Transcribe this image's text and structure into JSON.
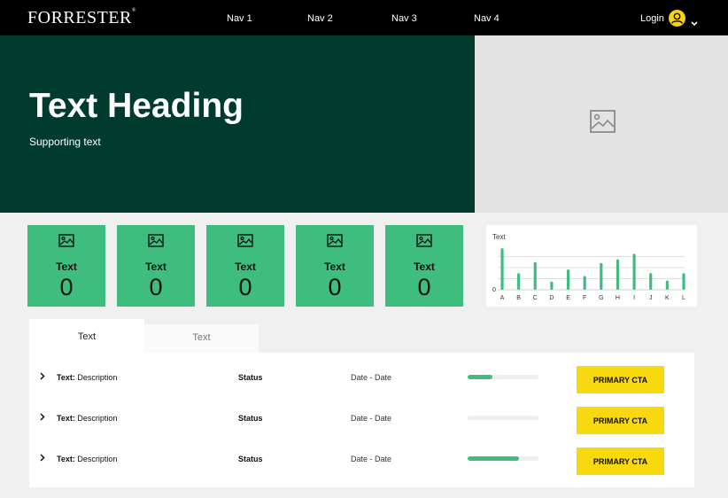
{
  "header": {
    "logo": "FORRESTER",
    "logo_mark": "®",
    "nav": [
      "Nav 1",
      "Nav 2",
      "Nav 3",
      "Nav 4"
    ],
    "login_label": "Login",
    "accent_color": "#f6d30b"
  },
  "hero": {
    "title": "Text Heading",
    "subtitle": "Supporting text",
    "background": "#003b2d",
    "image_icon": "image-placeholder-icon"
  },
  "cards": [
    {
      "label": "Text",
      "value": "0",
      "icon": "image-icon"
    },
    {
      "label": "Text",
      "value": "0",
      "icon": "image-icon"
    },
    {
      "label": "Text",
      "value": "0",
      "icon": "image-icon"
    },
    {
      "label": "Text",
      "value": "0",
      "icon": "image-icon"
    },
    {
      "label": "Text",
      "value": "0",
      "icon": "image-icon"
    }
  ],
  "chart_data": {
    "type": "bar",
    "title": "Text",
    "categories": [
      "A",
      "B",
      "C",
      "D",
      "E",
      "F",
      "G",
      "H",
      "I",
      "J",
      "K",
      "L"
    ],
    "values": [
      45,
      18,
      30,
      9,
      22,
      15,
      29,
      33,
      39,
      18,
      10,
      18
    ],
    "ylim": [
      0,
      48
    ],
    "y_tick_labels": [
      "0"
    ],
    "grid": true,
    "color": "#3ebd7f"
  },
  "tabs": [
    {
      "label": "Text",
      "active": true
    },
    {
      "label": "Text",
      "active": false
    }
  ],
  "rows": [
    {
      "label": "Text:",
      "description": "Description",
      "status": "Status",
      "date": "Date - Date",
      "progress": 0.35,
      "cta": "PRIMARY CTA"
    },
    {
      "label": "Text:",
      "description": "Description",
      "status": "Status",
      "date": "Date - Date",
      "progress": 0.0,
      "cta": "PRIMARY CTA"
    },
    {
      "label": "Text:",
      "description": "Description",
      "status": "Status",
      "date": "Date - Date",
      "progress": 0.72,
      "cta": "PRIMARY CTA"
    }
  ],
  "colors": {
    "card_green": "#3ebd7f",
    "cta_yellow": "#f8d90f"
  }
}
